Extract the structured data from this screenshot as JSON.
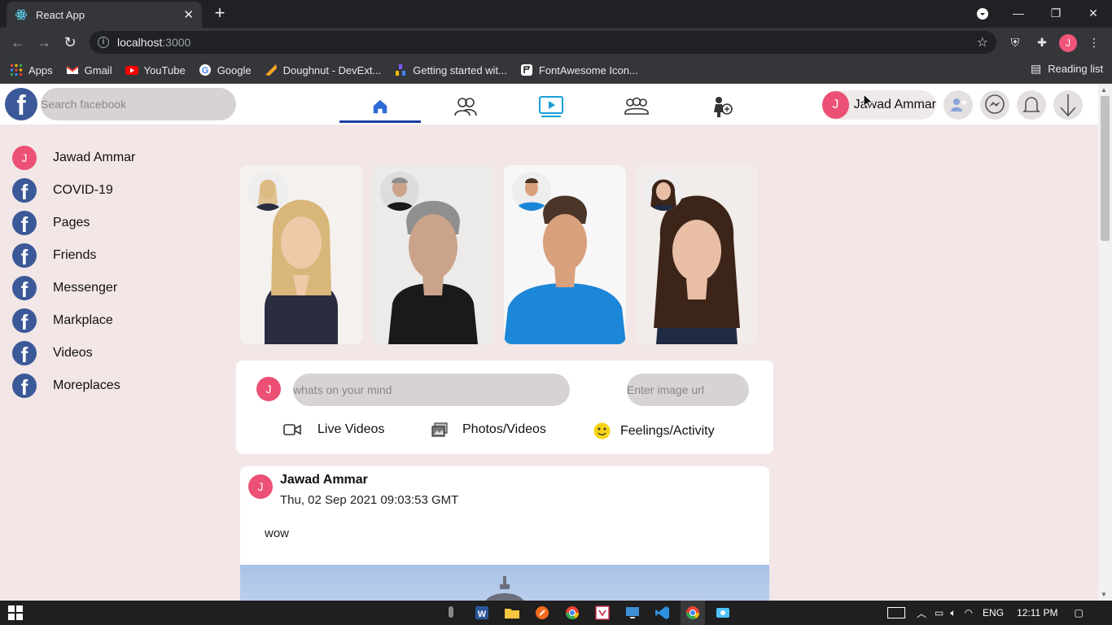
{
  "browser": {
    "tab_title": "React App",
    "tab_close": "✕",
    "new_tab": "+",
    "window_controls": {
      "minimize": "—",
      "restore": "❐",
      "close": "✕"
    },
    "url_host": "localhost",
    "url_port": ":3000",
    "bookmarks": [
      {
        "label": "Apps",
        "icon": "apps-grid-icon",
        "color": "#e8453c"
      },
      {
        "label": "Gmail",
        "icon": "gmail-icon",
        "color": "#ea4335"
      },
      {
        "label": "YouTube",
        "icon": "youtube-icon",
        "color": "#ff0000"
      },
      {
        "label": "Google",
        "icon": "google-icon",
        "color": "#ffffff"
      },
      {
        "label": "Doughnut - DevExt...",
        "icon": "devextreme-icon",
        "color": "#f5a623"
      },
      {
        "label": "Getting started wit...",
        "icon": "getting-started-icon",
        "color": "#7b5cff"
      },
      {
        "label": "FontAwesome Icon...",
        "icon": "fontawesome-icon",
        "color": "#ffffff"
      }
    ],
    "reading_list": "Reading list",
    "profile_initial": "J"
  },
  "header": {
    "logo": "f",
    "search_placeholder": "Search facebook",
    "user_initial": "J",
    "user_name": "Jawad Ammar",
    "accent": "#1c3fa8"
  },
  "sidebar": {
    "items": [
      {
        "label": "Jawad Ammar",
        "type": "avatar",
        "initial": "J"
      },
      {
        "label": "COVID-19",
        "type": "fb"
      },
      {
        "label": "Pages",
        "type": "fb"
      },
      {
        "label": "Friends",
        "type": "fb"
      },
      {
        "label": "Messenger",
        "type": "fb"
      },
      {
        "label": "Markplace",
        "type": "fb"
      },
      {
        "label": "Videos",
        "type": "fb"
      },
      {
        "label": "Moreplaces",
        "type": "fb"
      }
    ],
    "fb_glyph": "f"
  },
  "composer": {
    "avatar_initial": "J",
    "mind_placeholder": "whats on your mind",
    "url_placeholder": "Enter image url",
    "actions": [
      {
        "label": "Live Videos",
        "icon": "video-camera-icon"
      },
      {
        "label": "Photos/Videos",
        "icon": "photos-icon"
      },
      {
        "label": "Feelings/Activity",
        "icon": "smiley-icon"
      }
    ]
  },
  "post": {
    "avatar_initial": "J",
    "author": "Jawad Ammar",
    "date": "Thu, 02 Sep 2021 09:03:53 GMT",
    "text": "wow"
  },
  "taskbar": {
    "lang": "ENG",
    "time": "12:11 PM"
  }
}
